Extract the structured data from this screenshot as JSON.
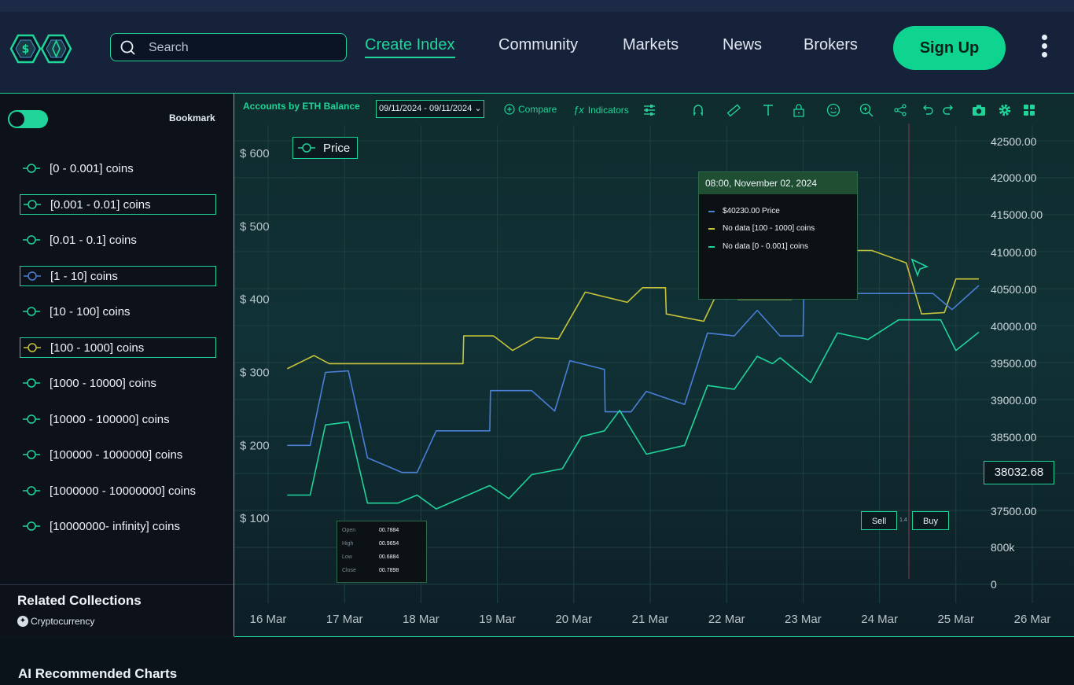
{
  "header": {
    "search_placeholder": "Search",
    "nav": [
      "Create Index",
      "Community",
      "Markets",
      "News",
      "Brokers"
    ],
    "signup_label": "Sign Up"
  },
  "sidebar": {
    "bookmark_label": "Bookmark",
    "series": [
      {
        "label": "[0 - 0.001] coins",
        "color": "#21d49a",
        "boxed": false
      },
      {
        "label": "[0.001 - 0.01] coins",
        "color": "#21d49a",
        "boxed": true
      },
      {
        "label": "[0.01 - 0.1] coins",
        "color": "#21d49a",
        "boxed": false
      },
      {
        "label": "[1 - 10] coins",
        "color": "#4a7fd6",
        "boxed": true
      },
      {
        "label": "[10 - 100] coins",
        "color": "#21d49a",
        "boxed": false
      },
      {
        "label": "[100 - 1000] coins",
        "color": "#c8c23a",
        "boxed": true
      },
      {
        "label": "[1000 - 10000] coins",
        "color": "#21d49a",
        "boxed": false
      },
      {
        "label": "[10000 - 100000] coins",
        "color": "#21d49a",
        "boxed": false
      },
      {
        "label": "[100000 - 1000000] coins",
        "color": "#21d49a",
        "boxed": false
      },
      {
        "label": "[1000000 - 10000000] coins",
        "color": "#21d49a",
        "boxed": false
      },
      {
        "label": "[10000000- infinity] coins",
        "color": "#21d49a",
        "boxed": false
      }
    ],
    "related_title": "Related Collections",
    "related_chip": "Cryptocurrency"
  },
  "toolbar": {
    "title": "Accounts by ETH Balance",
    "date_range": "09/11/2024 - 09/11/2024",
    "compare_label": "Compare",
    "indicators_label": "Indicators"
  },
  "legend_label": "Price",
  "tooltip": {
    "header": "08:00, November 02, 2024",
    "rows": [
      {
        "text": "$40230.00 Price",
        "color": "#4a7fd6"
      },
      {
        "text": "No data [100 - 1000] coins",
        "color": "#c8c23a"
      },
      {
        "text": "No data [0 - 0.001] coins",
        "color": "#21d49a"
      }
    ]
  },
  "ohlc": [
    {
      "k": "Open",
      "v": "00.7884"
    },
    {
      "k": "High",
      "v": "00.9654"
    },
    {
      "k": "Low",
      "v": "00.6884"
    },
    {
      "k": "Close",
      "v": "00.7898"
    }
  ],
  "trade": {
    "sell": "Sell",
    "buy": "Buy",
    "spread": "1.4"
  },
  "current_price": "38032.68",
  "bottom_title": "AI Recommended Charts",
  "chart_data": {
    "type": "line",
    "x": [
      "16 Mar",
      "17 Mar",
      "18 Mar",
      "19 Mar",
      "20 Mar",
      "21 Mar",
      "22 Mar",
      "23 Mar",
      "24 Mar",
      "25 Mar",
      "26 Mar"
    ],
    "y_left_ticks": [
      "$ 600",
      "$ 500",
      "$ 400",
      "$ 300",
      "$ 200",
      "$ 100"
    ],
    "y_left_range": [
      0,
      600
    ],
    "y_right_ticks": [
      "42500.00",
      "42000.00",
      "415000.00",
      "41000.00",
      "40500.00",
      "40000.00",
      "39500.00",
      "39000.00",
      "38500.00",
      "37500.00",
      "800k",
      "0"
    ],
    "grid": true,
    "series": [
      {
        "color": "#c8c23a",
        "points": [
          [
            16.25,
            305
          ],
          [
            16.6,
            323
          ],
          [
            16.8,
            312
          ],
          [
            17.5,
            312
          ],
          [
            17.9,
            312
          ],
          [
            18.55,
            312
          ],
          [
            18.56,
            350
          ],
          [
            18.95,
            350
          ],
          [
            19.2,
            330
          ],
          [
            19.5,
            348
          ],
          [
            19.8,
            346
          ],
          [
            20.15,
            410
          ],
          [
            20.7,
            396
          ],
          [
            20.9,
            416
          ],
          [
            21.2,
            416
          ],
          [
            21.21,
            380
          ],
          [
            21.7,
            370
          ],
          [
            21.9,
            414
          ],
          [
            22.15,
            400
          ],
          [
            22.85,
            400
          ],
          [
            22.86,
            430
          ],
          [
            23.4,
            430
          ],
          [
            23.7,
            467
          ],
          [
            23.9,
            467
          ],
          [
            24.35,
            450
          ],
          [
            24.55,
            380
          ],
          [
            24.85,
            382
          ],
          [
            25.0,
            428
          ],
          [
            25.3,
            428
          ]
        ]
      },
      {
        "color": "#4a7fd6",
        "points": [
          [
            16.25,
            200
          ],
          [
            16.55,
            200
          ],
          [
            16.75,
            300
          ],
          [
            17.05,
            302
          ],
          [
            17.3,
            183
          ],
          [
            17.75,
            163
          ],
          [
            17.95,
            163
          ],
          [
            18.2,
            220
          ],
          [
            18.9,
            220
          ],
          [
            18.91,
            275
          ],
          [
            19.45,
            275
          ],
          [
            19.75,
            247
          ],
          [
            19.95,
            316
          ],
          [
            20.4,
            304
          ],
          [
            20.41,
            246
          ],
          [
            20.75,
            246
          ],
          [
            20.95,
            274
          ],
          [
            21.45,
            256
          ],
          [
            21.75,
            354
          ],
          [
            22.1,
            350
          ],
          [
            22.4,
            385
          ],
          [
            22.7,
            350
          ],
          [
            23.0,
            350
          ],
          [
            23.01,
            408
          ],
          [
            23.7,
            408
          ],
          [
            24.7,
            408
          ],
          [
            24.95,
            386
          ],
          [
            25.3,
            419
          ]
        ]
      },
      {
        "color": "#21d49a",
        "points": [
          [
            16.25,
            132
          ],
          [
            16.55,
            132
          ],
          [
            16.75,
            228
          ],
          [
            17.05,
            232
          ],
          [
            17.3,
            121
          ],
          [
            17.7,
            121
          ],
          [
            17.95,
            132
          ],
          [
            18.2,
            113
          ],
          [
            18.9,
            145
          ],
          [
            19.15,
            127
          ],
          [
            19.45,
            160
          ],
          [
            19.85,
            168
          ],
          [
            20.1,
            212
          ],
          [
            20.4,
            220
          ],
          [
            20.6,
            248
          ],
          [
            20.95,
            188
          ],
          [
            21.45,
            200
          ],
          [
            21.75,
            282
          ],
          [
            22.1,
            277
          ],
          [
            22.4,
            322
          ],
          [
            22.6,
            312
          ],
          [
            22.7,
            320
          ],
          [
            23.1,
            286
          ],
          [
            23.45,
            354
          ],
          [
            23.85,
            345
          ],
          [
            24.25,
            372
          ],
          [
            24.8,
            372
          ],
          [
            25.0,
            330
          ],
          [
            25.3,
            355
          ]
        ]
      }
    ]
  }
}
